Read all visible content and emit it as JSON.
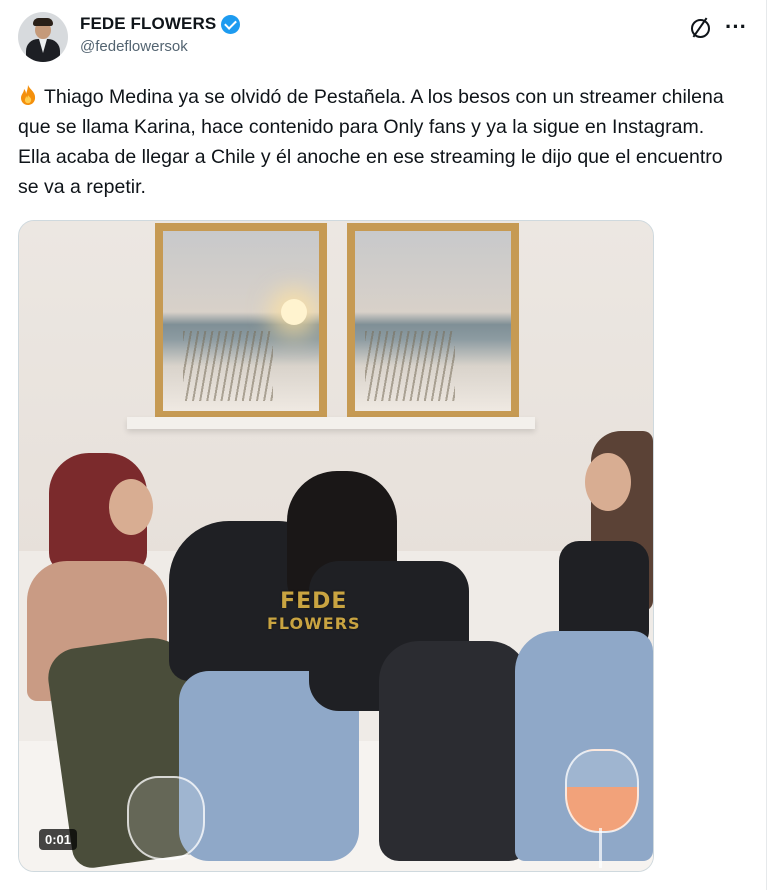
{
  "author": {
    "display_name": "FEDE FLOWERS",
    "handle": "@fedeflowersok",
    "verified_icon": "verified-badge-icon"
  },
  "actions": {
    "grok_icon": "grok-icon",
    "more_label": "···"
  },
  "tweet": {
    "emoji_icon": "fire-icon",
    "text": "Thiago Medina ya se olvidó de Pestañela.  A los besos con un streamer chilena que se llama Karina,  hace contenido para Only fans y ya la sigue en Instagram. Ella acaba de llegar a Chile y él anoche en ese streaming le dijo que el encuentro se va a repetir."
  },
  "media": {
    "watermark_line1": "FEDE",
    "watermark_line2": "FLOWERS",
    "timestamp": "0:01"
  },
  "colors": {
    "accent": "#1d9bf0",
    "text": "#0f1419",
    "secondary_text": "#536471"
  }
}
